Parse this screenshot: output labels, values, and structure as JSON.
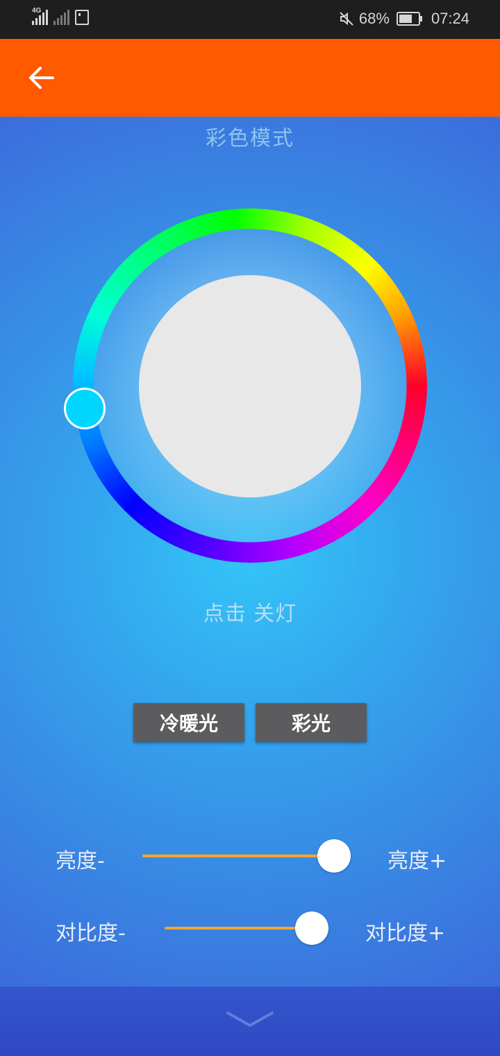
{
  "status_bar": {
    "network_label": "4G",
    "battery": "68%",
    "time": "07:24",
    "icons": [
      "signal-4g-icon",
      "signal-nosim-icon",
      "sim-card-icon",
      "mute-icon",
      "battery-icon"
    ]
  },
  "toolbar": {
    "back_icon": "arrow-left-icon",
    "color": "#ff5a00"
  },
  "main": {
    "mode_title": "彩色模式",
    "hint": "点击 关灯",
    "selected_color": "#00d6ff",
    "buttons": {
      "warm_cool": "冷暖光",
      "color": "彩光"
    }
  },
  "sliders": {
    "brightness": {
      "minus_label": "亮度-",
      "plus_label": "亮度+",
      "value": 1.0
    },
    "contrast": {
      "minus_label": "对比度-",
      "plus_label": "对比度+",
      "value": 0.9
    }
  },
  "bottom_bar": {
    "icon": "chevron-down-icon"
  }
}
